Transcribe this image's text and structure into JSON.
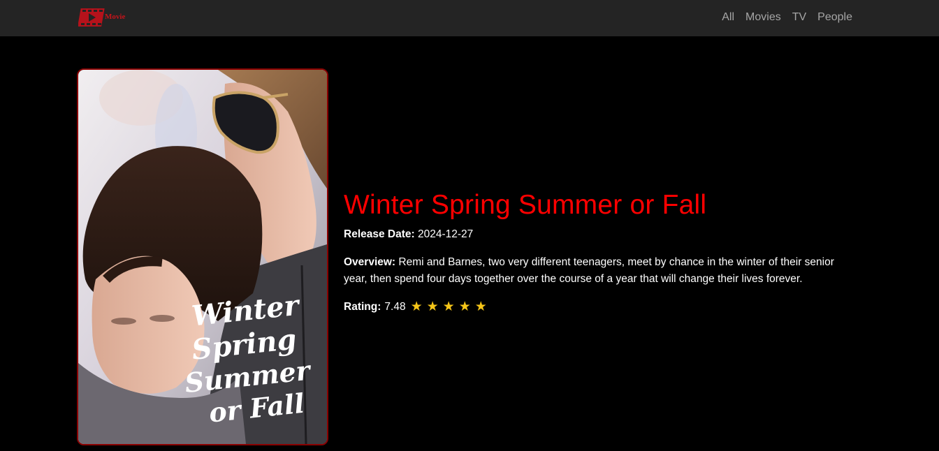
{
  "brand": {
    "name": "Movie",
    "icon": "film-clapper-icon",
    "color": "#c4141a"
  },
  "nav": {
    "items": [
      {
        "label": "All"
      },
      {
        "label": "Movies"
      },
      {
        "label": "TV"
      },
      {
        "label": "People"
      }
    ]
  },
  "poster": {
    "title_lines": [
      "Winter",
      "Spring",
      "Summer",
      "or Fall"
    ]
  },
  "movie": {
    "title": "Winter Spring Summer or Fall",
    "release_label": "Release Date:",
    "release_date": "2024-12-27",
    "overview_label": "Overview:",
    "overview": "Remi and Barnes, two very different teenagers, meet by chance in the winter of their senior year, then spend four days together over the course of a year that will change their lives forever.",
    "rating_label": "Rating:",
    "rating": "7.48",
    "stars_filled": 5,
    "title_color": "#ff0000",
    "star_color": "#f5c518"
  }
}
